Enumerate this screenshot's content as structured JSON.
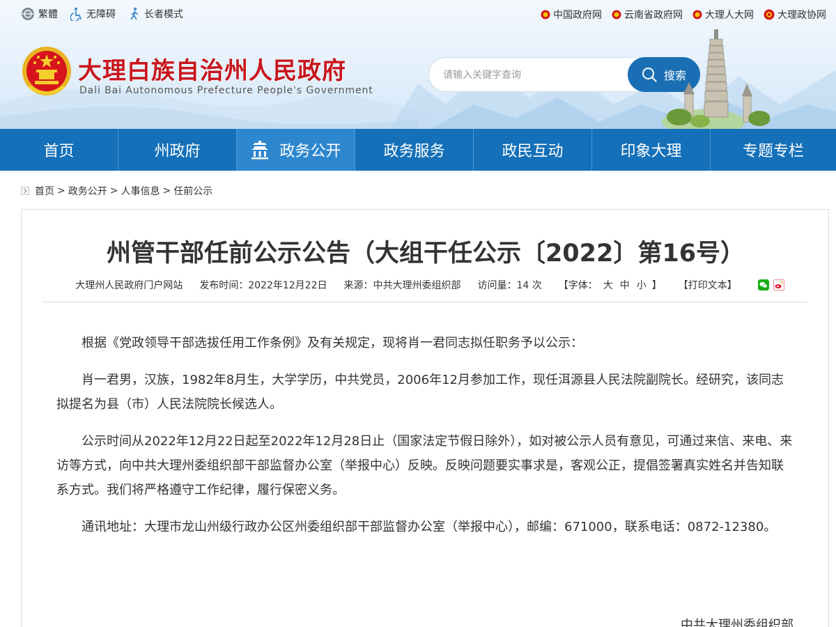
{
  "accessibility": {
    "traditional": "繁體",
    "accessible": "无障碍",
    "elder": "长者模式"
  },
  "top_links": [
    "中国政府网",
    "云南省政府网",
    "大理人大网",
    "大理政协网"
  ],
  "site": {
    "title": "大理白族自治州人民政府",
    "subtitle": "Dali Bai Autonomous Prefecture People's Government"
  },
  "search": {
    "placeholder": "请输入关键字查询",
    "button": "搜索"
  },
  "nav": {
    "items": [
      "首页",
      "州政府",
      "政务公开",
      "政务服务",
      "政民互动",
      "印象大理",
      "专题专栏"
    ],
    "active_index": 2
  },
  "breadcrumb": [
    "首页",
    "政务公开",
    "人事信息",
    "任前公示"
  ],
  "breadcrumb_separator": ">",
  "article": {
    "title": "州管干部任前公示公告（大组干任公示〔2022〕第16号）",
    "meta": {
      "source_site": "大理州人民政府门户网站",
      "publish_label": "发布时间：",
      "publish_date": "2022年12月22日",
      "source_label": "来源：",
      "source": "中共大理州委组织部",
      "visits_label": "访问量：",
      "visits": "14",
      "visits_unit": "次",
      "font_label": "【字体：",
      "font_large": "大",
      "font_medium": "中",
      "font_small": "小",
      "font_close": "】",
      "print": "【打印文本】"
    },
    "paragraphs": [
      "根据《党政领导干部选拔任用工作条例》及有关规定，现将肖一君同志拟任职务予以公示：",
      "肖一君男，汉族，1982年8月生，大学学历，中共党员，2006年12月参加工作，现任洱源县人民法院副院长。经研究，该同志拟提名为县（市）人民法院院长候选人。",
      "公示时间从2022年12月22日起至2022年12月28日止（国家法定节假日除外），如对被公示人员有意见，可通过来信、来电、来访等方式，向中共大理州委组织部干部监督办公室（举报中心）反映。反映问题要实事求是，客观公正，提倡签署真实姓名并告知联系方式。我们将严格遵守工作纪律，履行保密义务。",
      "通讯地址：大理市龙山州级行政办公区州委组织部干部监督办公室（举报中心），邮编：671000，联系电话：0872-12380。"
    ],
    "signature": "中共大理州委组织部"
  },
  "colors": {
    "brand_red": "#c8161d",
    "nav_blue": "#1470b8",
    "nav_active": "#2d87cf",
    "wechat_green": "#1aad19",
    "weibo_red": "#e6162d"
  },
  "icons": {
    "traditional": "globe-icon",
    "accessible": "wheelchair-icon",
    "elder": "person-walking-icon",
    "top_links": "national-emblem-icon",
    "search": "magnifier-icon",
    "nav_active": "temple-icon",
    "breadcrumb": "home-icon",
    "share": [
      "wechat-icon",
      "weibo-icon"
    ]
  }
}
